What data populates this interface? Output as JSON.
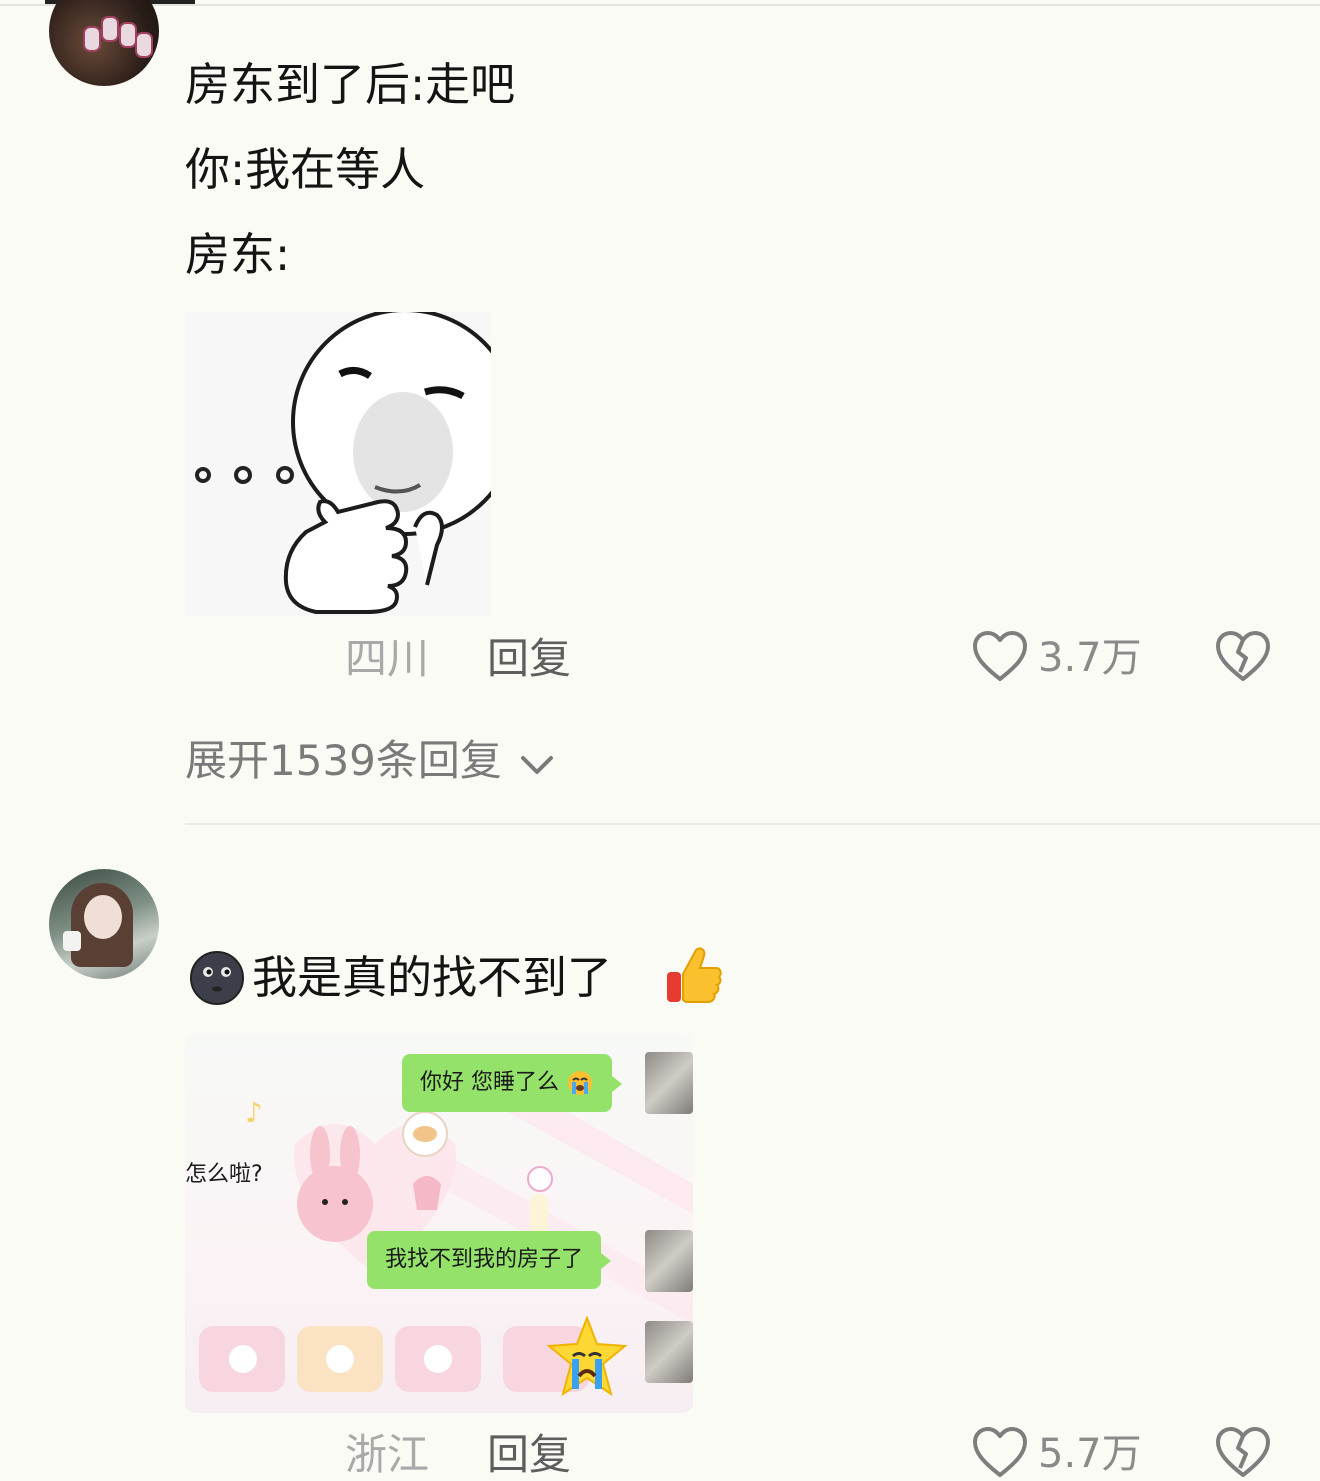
{
  "comment1": {
    "lines": [
      "房东到了后:走吧",
      "你:我在等人",
      "房东:"
    ],
    "location": "四川",
    "reply_label": "回复",
    "likes": "3.7万",
    "expand_text": "展开1539条回复"
  },
  "comment2": {
    "text": "我是真的找不到了",
    "location": "浙江",
    "reply_label": "回复",
    "likes": "5.7万",
    "screenshot": {
      "bubble1": "你好 您睡了么",
      "left_message": "怎么啦?",
      "bubble2": "我找不到我的房子了"
    }
  },
  "colors": {
    "background": "#fbfbf6",
    "chat_bubble": "#95e26b",
    "muted_text": "#a9a9a9"
  },
  "icons": [
    "heart-icon",
    "dislike-icon",
    "chevron-down-icon",
    "new-moon-face-emoji",
    "thumbs-up-emoji",
    "crying-emoji"
  ]
}
